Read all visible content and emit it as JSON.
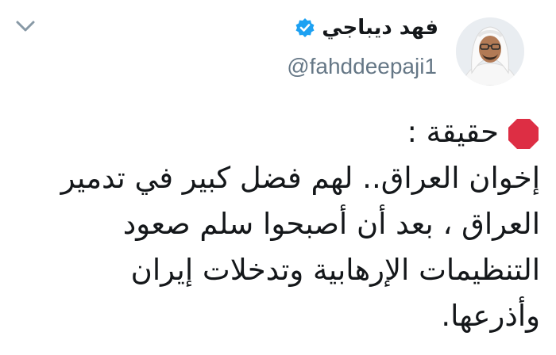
{
  "author": {
    "display_name": "فهد ديباجي",
    "handle": "@fahddeepaji1",
    "verified": true,
    "avatar_icon": "profile-photo"
  },
  "header": {
    "menu_icon": "chevron-down-icon"
  },
  "tweet": {
    "emoji_icon": "octagonal-stop-sign-icon",
    "emoji_color": "#dd2e44",
    "lines": [
      "حقيقة :",
      "إخوان العراق.. لهم فضل كبير في تدمير",
      "العراق ، بعد أن أصبحوا سلم صعود",
      "التنظيمات الإرهابية وتدخلات إيران",
      "وأذرعها."
    ]
  },
  "colors": {
    "verified_blue": "#1da1f2",
    "handle_gray": "#657786",
    "text": "#14171a"
  }
}
